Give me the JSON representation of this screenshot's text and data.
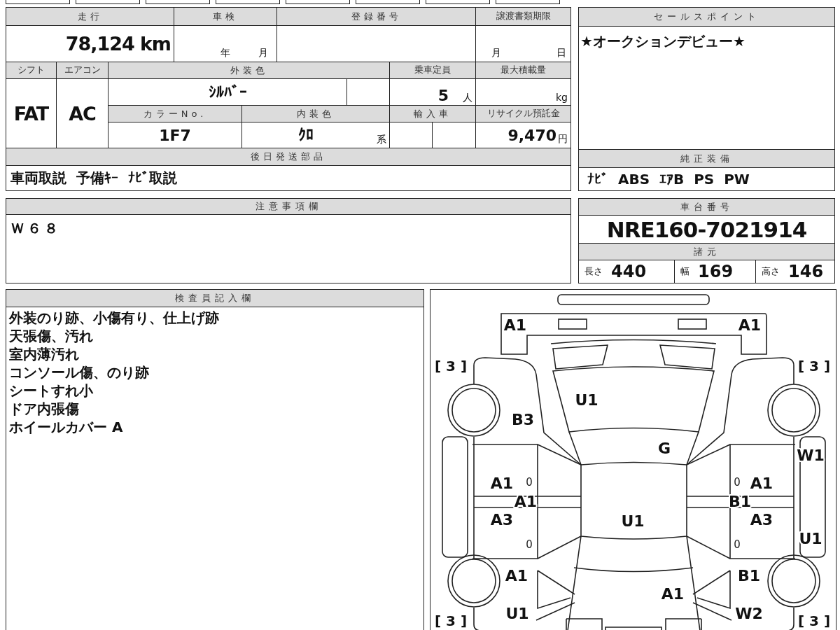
{
  "mileage": {
    "label": "走行",
    "value": "78,124",
    "unit": "km"
  },
  "inspection": {
    "label": "車検",
    "year_unit": "年",
    "month_unit": "月"
  },
  "registration_number": {
    "label": "登録番号"
  },
  "transfer_deadline": {
    "label": "譲渡書類期限",
    "month_unit": "月",
    "day_unit": "日"
  },
  "shift": {
    "label": "シフト",
    "value": "FAT"
  },
  "air_conditioner": {
    "label": "エアコン",
    "value": "AC"
  },
  "exterior_color": {
    "label": "外装色",
    "value": "ｼﾙﾊﾞｰ"
  },
  "capacity": {
    "label": "乗車定員",
    "value": "5",
    "unit": "人"
  },
  "max_load": {
    "label": "最大積載量",
    "unit": "kg"
  },
  "color_number": {
    "label": "カラーNo.",
    "value": "1F7"
  },
  "interior_color": {
    "label": "内装色",
    "value": "ｸﾛ",
    "unit": "系"
  },
  "imported": {
    "label": "輸入車"
  },
  "recycle_fee": {
    "label": "リサイクル預託金",
    "value": "9,470",
    "unit": "円"
  },
  "parts_sent_later": {
    "label": "後日発送部品",
    "value": "車両取説  予備ｷｰ  ﾅﾋﾞ取説"
  },
  "sales_point": {
    "label": "セールスポイント",
    "value": "★オークションデビュー★"
  },
  "factory_equipment": {
    "label": "純正装備",
    "value": "ﾅﾋﾞ  ABS  ｴｱB  PS  PW"
  },
  "notes": {
    "label": "注意事項欄",
    "value": "Ｗ６８"
  },
  "chassis_number": {
    "label": "車台番号",
    "value": "NRE160-7021914"
  },
  "specs": {
    "label": "諸元",
    "items": [
      {
        "label": "長さ",
        "value": "440"
      },
      {
        "label": "幅",
        "value": "169"
      },
      {
        "label": "高さ",
        "value": "146"
      }
    ]
  },
  "inspector_notes": {
    "label": "検査員記入欄",
    "lines": [
      "外装のり跡、小傷有り、仕上げ跡",
      "天張傷、汚れ",
      "室内薄汚れ",
      "コンソール傷、のり跡",
      "シートすれ小",
      "ドア内張傷",
      "ホイールカバー A"
    ]
  },
  "damage_map": {
    "marks": [
      {
        "kind": "code",
        "text": "A1"
      },
      {
        "kind": "code",
        "text": "A1"
      },
      {
        "kind": "bracket",
        "text": "[ 3 ]"
      },
      {
        "kind": "bracket",
        "text": "[ 3 ]"
      },
      {
        "kind": "code",
        "text": "U1"
      },
      {
        "kind": "code",
        "text": "B3"
      },
      {
        "kind": "code",
        "text": "G"
      },
      {
        "kind": "code",
        "text": "W1"
      },
      {
        "kind": "code",
        "text": "A1"
      },
      {
        "kind": "small",
        "text": "0"
      },
      {
        "kind": "small",
        "text": "0"
      },
      {
        "kind": "code",
        "text": "A1"
      },
      {
        "kind": "code",
        "text": "A1"
      },
      {
        "kind": "code",
        "text": "B1"
      },
      {
        "kind": "code",
        "text": "A3"
      },
      {
        "kind": "code",
        "text": "U1"
      },
      {
        "kind": "code",
        "text": "A3"
      },
      {
        "kind": "small",
        "text": "0"
      },
      {
        "kind": "small",
        "text": "0"
      },
      {
        "kind": "code",
        "text": "U1"
      },
      {
        "kind": "code",
        "text": "A1"
      },
      {
        "kind": "code",
        "text": "B1"
      },
      {
        "kind": "code",
        "text": "A1"
      },
      {
        "kind": "code",
        "text": "U1"
      },
      {
        "kind": "code",
        "text": "W2"
      },
      {
        "kind": "bracket",
        "text": "[ 3 ]"
      },
      {
        "kind": "bracket",
        "text": "[ 3 ]"
      }
    ]
  }
}
